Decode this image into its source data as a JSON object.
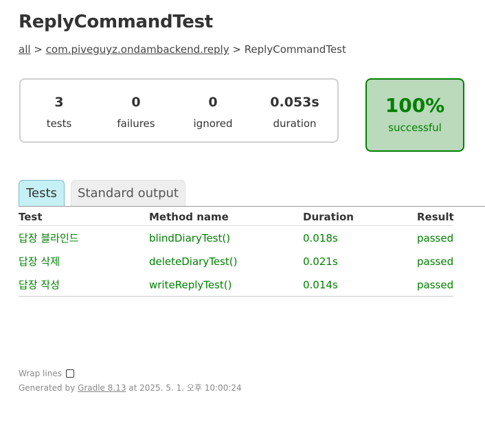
{
  "page": {
    "title": "ReplyCommandTest"
  },
  "breadcrumb": {
    "all_link": "all",
    "sep1": " > ",
    "package_link": "com.piveguyz.ondambackend.reply",
    "sep2": " > ",
    "current": "ReplyCommandTest"
  },
  "summary": {
    "tests": {
      "value": "3",
      "label": "tests"
    },
    "failures": {
      "value": "0",
      "label": "failures"
    },
    "ignored": {
      "value": "0",
      "label": "ignored"
    },
    "duration": {
      "value": "0.053s",
      "label": "duration"
    },
    "success": {
      "percent": "100%",
      "label": "successful",
      "status_color": "#008000",
      "background_color": "#bbd9bb"
    }
  },
  "tabs": [
    {
      "label": "Tests",
      "active": true
    },
    {
      "label": "Standard output",
      "active": false
    }
  ],
  "table": {
    "headers": [
      "Test",
      "Method name",
      "Duration",
      "Result"
    ],
    "rows": [
      {
        "test": "답장 블라인드",
        "method": "blindDiaryTest()",
        "duration": "0.018s",
        "result": "passed"
      },
      {
        "test": "답장 삭제",
        "method": "deleteDiaryTest()",
        "duration": "0.021s",
        "result": "passed"
      },
      {
        "test": "답장 작성",
        "method": "writeReplyTest()",
        "duration": "0.014s",
        "result": "passed"
      }
    ],
    "passed_color": "#008000"
  },
  "footer": {
    "wrap_lines_label": "Wrap lines",
    "wrap_lines_checked": false,
    "generated_prefix": "Generated by ",
    "gradle_link": "Gradle 8.13",
    "generated_suffix": " at 2025. 5. 1. 오후 10:00:24"
  }
}
